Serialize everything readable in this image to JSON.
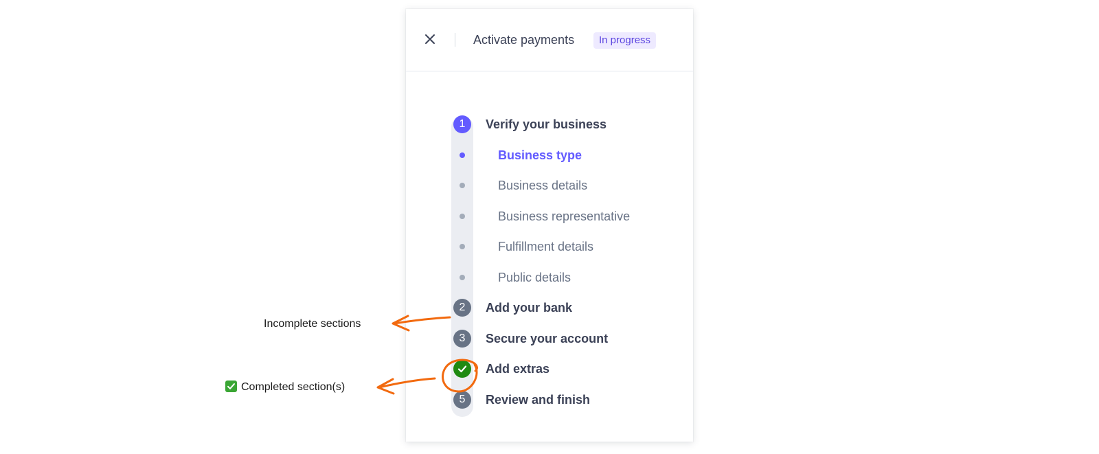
{
  "header": {
    "close_icon": "close-icon",
    "title": "Activate payments",
    "status": "In progress",
    "status_color": "#5b45e0",
    "status_bg": "#eeeaff"
  },
  "steps": [
    {
      "number": "1",
      "label": "Verify your business",
      "state": "active",
      "substeps": [
        {
          "label": "Business type",
          "state": "active"
        },
        {
          "label": "Business details",
          "state": "pending"
        },
        {
          "label": "Business representative",
          "state": "pending"
        },
        {
          "label": "Fulfillment details",
          "state": "pending"
        },
        {
          "label": "Public details",
          "state": "pending"
        }
      ]
    },
    {
      "number": "2",
      "label": "Add your bank",
      "state": "incomplete"
    },
    {
      "number": "3",
      "label": "Secure your account",
      "state": "incomplete"
    },
    {
      "number": "",
      "label": "Add extras",
      "state": "complete",
      "icon": "checkmark-icon"
    },
    {
      "number": "5",
      "label": "Review and finish",
      "state": "incomplete"
    }
  ],
  "annotations": {
    "incomplete": "Incomplete sections",
    "completed": "Completed section(s)",
    "arrow_color": "#f26a0f"
  },
  "colors": {
    "accent": "#635bff",
    "complete": "#1f8a12",
    "pending": "#687385",
    "text": "#3c4257"
  }
}
